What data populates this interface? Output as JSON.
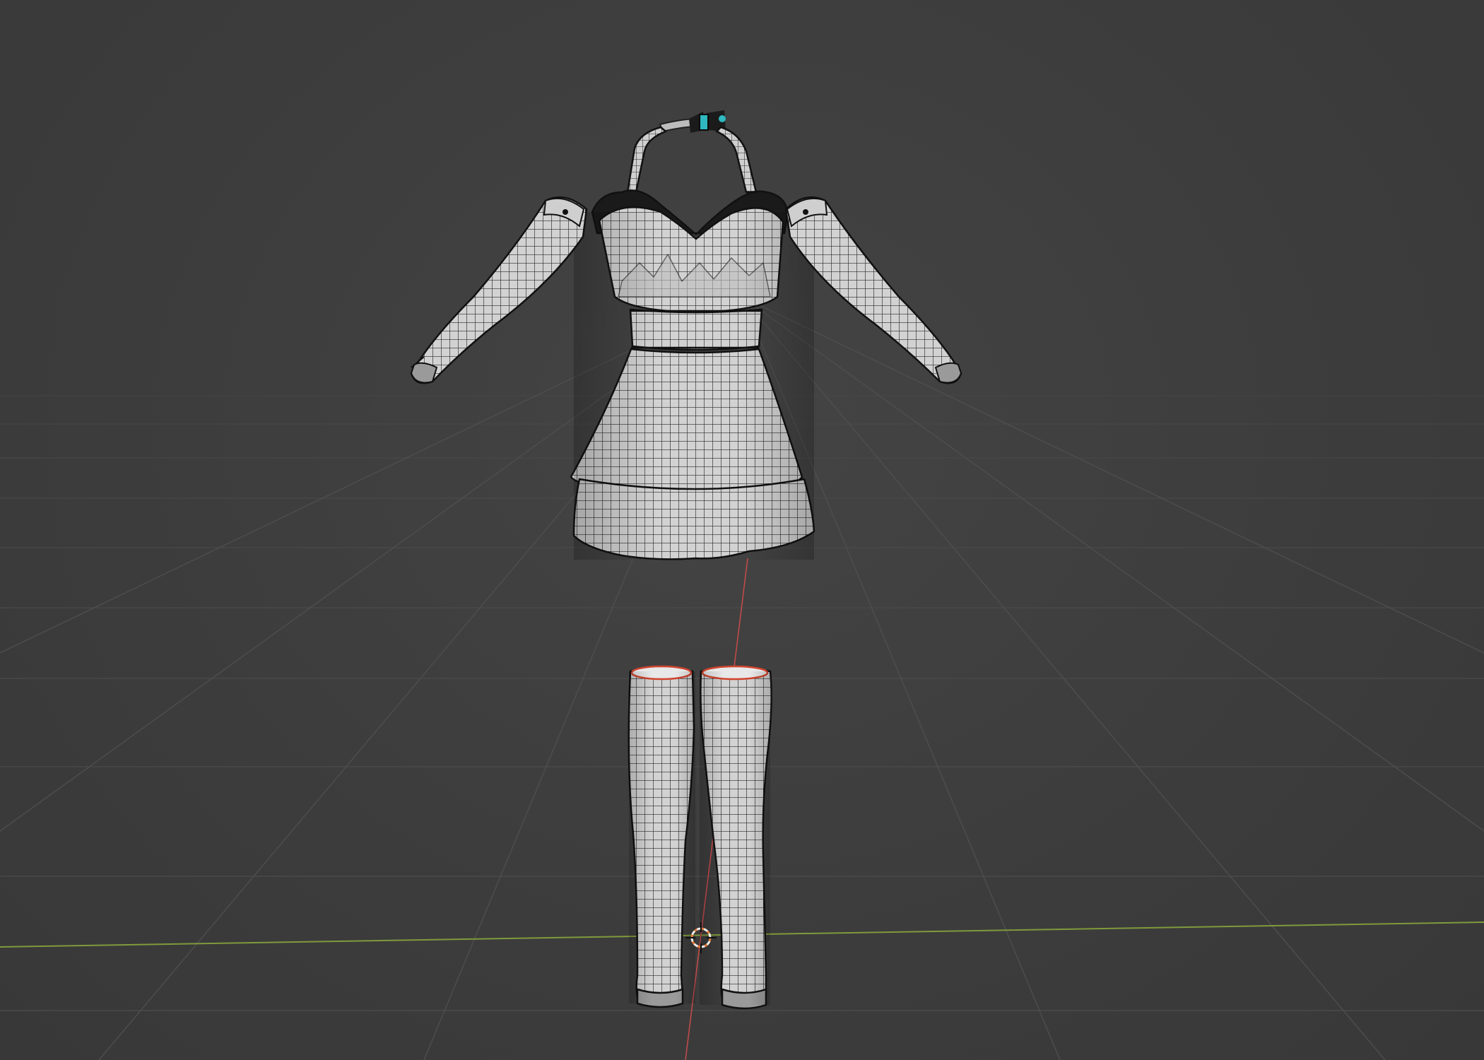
{
  "viewport": {
    "mode": "3d-viewport",
    "shading": "solid-wireframe-overlay",
    "grid_floor": true,
    "axis_x_color": "#7f9a3c",
    "axis_y_color": "#c14a4a",
    "background_color": "#3d3d3d"
  },
  "scene": {
    "objects": [
      {
        "name": "choker-bow",
        "icon": "bow-icon"
      },
      {
        "name": "dress",
        "icon": "mesh-icon"
      },
      {
        "name": "sleeve-left",
        "icon": "mesh-icon"
      },
      {
        "name": "sleeve-right",
        "icon": "mesh-icon"
      },
      {
        "name": "boot-left",
        "icon": "mesh-icon"
      },
      {
        "name": "boot-right",
        "icon": "mesh-icon"
      }
    ],
    "cursor": {
      "icon": "3d-cursor-icon",
      "color": "#e07a3a"
    },
    "mesh_colors": {
      "surface": "#d4d4d4",
      "wire": "#1e1e1e",
      "accent": "#2fb8c0",
      "boot_rim": "#d0442e"
    }
  }
}
